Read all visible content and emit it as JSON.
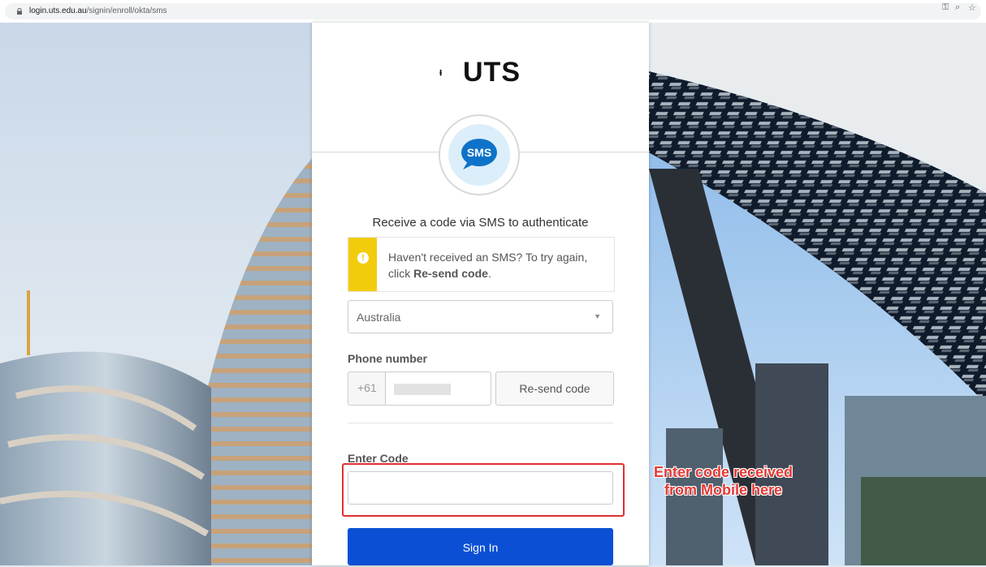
{
  "browser": {
    "url_domain": "login.uts.edu.au",
    "url_path": "/signin/enroll/okta/sms"
  },
  "logo": {
    "text": "UTS"
  },
  "factor": {
    "badge": "SMS"
  },
  "form": {
    "title": "Receive a code via SMS to authenticate",
    "warning_text_before": "Haven't received an SMS? To try again, click ",
    "warning_text_bold": "Re-send code",
    "warning_text_after": ".",
    "country_value": "Australia",
    "phone_label": "Phone number",
    "phone_prefix": "+61",
    "resend_label": "Re-send code",
    "code_label": "Enter Code",
    "code_value": "",
    "signin_label": "Sign In"
  },
  "annotation": {
    "line1": "Enter code received",
    "line2": "from Mobile here",
    "color": "#e53935"
  },
  "colors": {
    "primary_button": "#0b50d4",
    "warning": "#f2cc0c"
  }
}
